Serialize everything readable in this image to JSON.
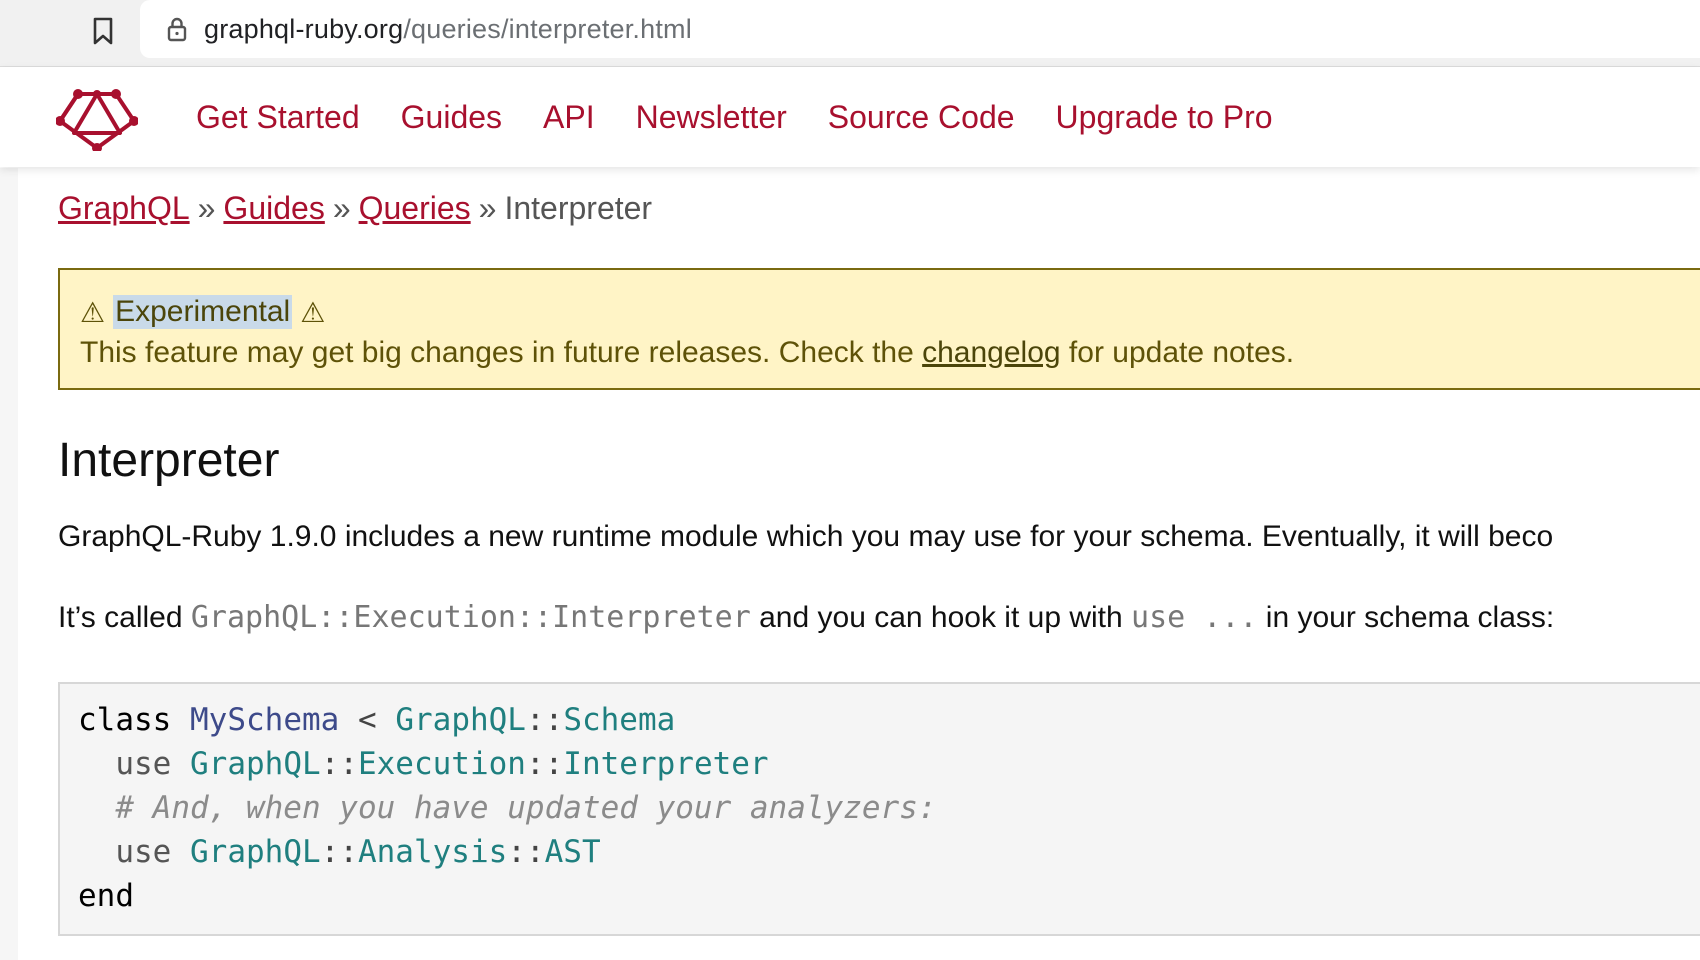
{
  "browser": {
    "url_host": "graphql-ruby.org",
    "url_path": "/queries/interpreter.html",
    "icons": [
      "bookmark-icon",
      "lock-icon"
    ]
  },
  "header": {
    "logo": "graphql-logo-icon",
    "nav": [
      "Get Started",
      "Guides",
      "API",
      "Newsletter",
      "Source Code",
      "Upgrade to Pro"
    ],
    "accent_color": "#a8102e"
  },
  "breadcrumb": {
    "items": [
      "GraphQL",
      "Guides",
      "Queries"
    ],
    "separator": "»",
    "current": "Interpreter"
  },
  "callout": {
    "warn_glyph": "⚠",
    "title": "Experimental",
    "text_before": "This feature may get big changes in future releases. Check the ",
    "link": "changelog",
    "text_after": " for update notes."
  },
  "main": {
    "title": "Interpreter",
    "p1": "GraphQL-Ruby 1.9.0 includes a new runtime module which you may use for your schema. Eventually, it will beco",
    "p2_a": "It’s called ",
    "p2_code1": "GraphQL::Execution::Interpreter",
    "p2_b": " and you can hook it up with ",
    "p2_code2": "use ...",
    "p2_c": " in your schema class:"
  },
  "code": {
    "l1_kw": "class",
    "l1_cls": "MySchema",
    "l1_op": "<",
    "l1_c1": "GraphQL",
    "l1_sep": "::",
    "l1_c2": "Schema",
    "l2_use": "use",
    "l2_c1": "GraphQL",
    "l2_sep1": "::",
    "l2_c2": "Execution",
    "l2_sep2": "::",
    "l2_c3": "Interpreter",
    "l3_comment": "# And, when you have updated your analyzers:",
    "l4_use": "use",
    "l4_c1": "GraphQL",
    "l4_sep1": "::",
    "l4_c2": "Analysis",
    "l4_sep2": "::",
    "l4_c3": "AST",
    "l5_kw": "end"
  }
}
